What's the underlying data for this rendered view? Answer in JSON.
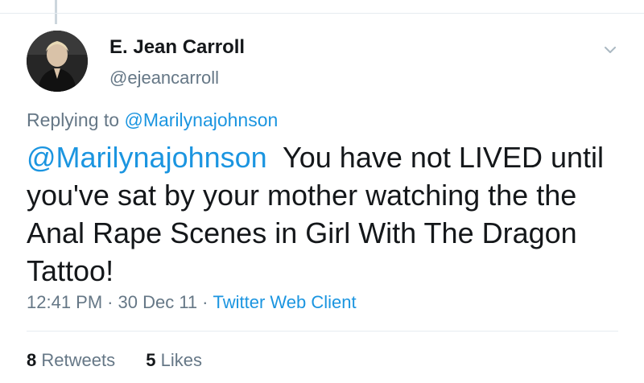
{
  "author": {
    "display_name": "E. Jean Carroll",
    "handle": "@ejeancarroll"
  },
  "replying": {
    "prefix": "Replying to",
    "mention": "@Marilynajohnson"
  },
  "tweet": {
    "mention": "@Marilynajohnson",
    "text": "You have not LIVED until you've sat by your mother watching the the Anal Rape Scenes in Girl With The Dragon Tattoo!"
  },
  "meta": {
    "time": "12:41 PM",
    "separator": "·",
    "date": "30 Dec 11",
    "client": "Twitter Web Client"
  },
  "stats": {
    "retweets_count": "8",
    "retweets_label": "Retweets",
    "likes_count": "5",
    "likes_label": "Likes"
  },
  "colors": {
    "link": "#1b95e0",
    "secondary_text": "#657786",
    "primary_text": "#14171a",
    "divider": "#e6ecf0"
  },
  "icons": {
    "menu": "chevron-down-icon"
  }
}
